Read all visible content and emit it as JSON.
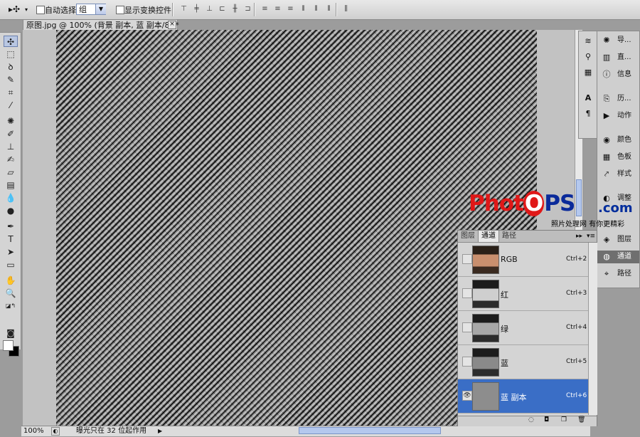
{
  "options_bar": {
    "auto_select_label": "自动选择:",
    "auto_select_value": "组",
    "show_transform_label": "显示变换控件"
  },
  "document": {
    "tab_title": "原图.jpg @ 100% (背景 副本, 蓝 副本/8) *"
  },
  "status_bar": {
    "zoom": "100%",
    "info": "曝光只在 32 位起作用"
  },
  "dock": {
    "items": [
      {
        "label": "导..."
      },
      {
        "label": "直..."
      },
      {
        "label": "信息"
      },
      {
        "label": "历..."
      },
      {
        "label": "动作"
      },
      {
        "label": "颜色"
      },
      {
        "label": "色板"
      },
      {
        "label": "样式"
      },
      {
        "label": "调整"
      },
      {
        "label": "图层"
      },
      {
        "label": "通道"
      },
      {
        "label": "路径"
      }
    ]
  },
  "channels_panel": {
    "tabs": [
      "图层",
      "通道",
      "路径"
    ],
    "active_tab": "通道",
    "rows": [
      {
        "name": "RGB",
        "shortcut": "Ctrl+2"
      },
      {
        "name": "红",
        "shortcut": "Ctrl+3"
      },
      {
        "name": "绿",
        "shortcut": "Ctrl+4"
      },
      {
        "name": "蓝",
        "shortcut": "Ctrl+5"
      },
      {
        "name": "蓝 副本",
        "shortcut": "Ctrl+6"
      }
    ]
  },
  "watermark": {
    "logo_text": "PhotoPS",
    "domain": ".com",
    "tagline": "照片处理网 有你更精彩"
  },
  "colors": {
    "selected_row": "#3a6ec6",
    "logo_red": "#e01818",
    "logo_blue": "#0a2a9a"
  }
}
